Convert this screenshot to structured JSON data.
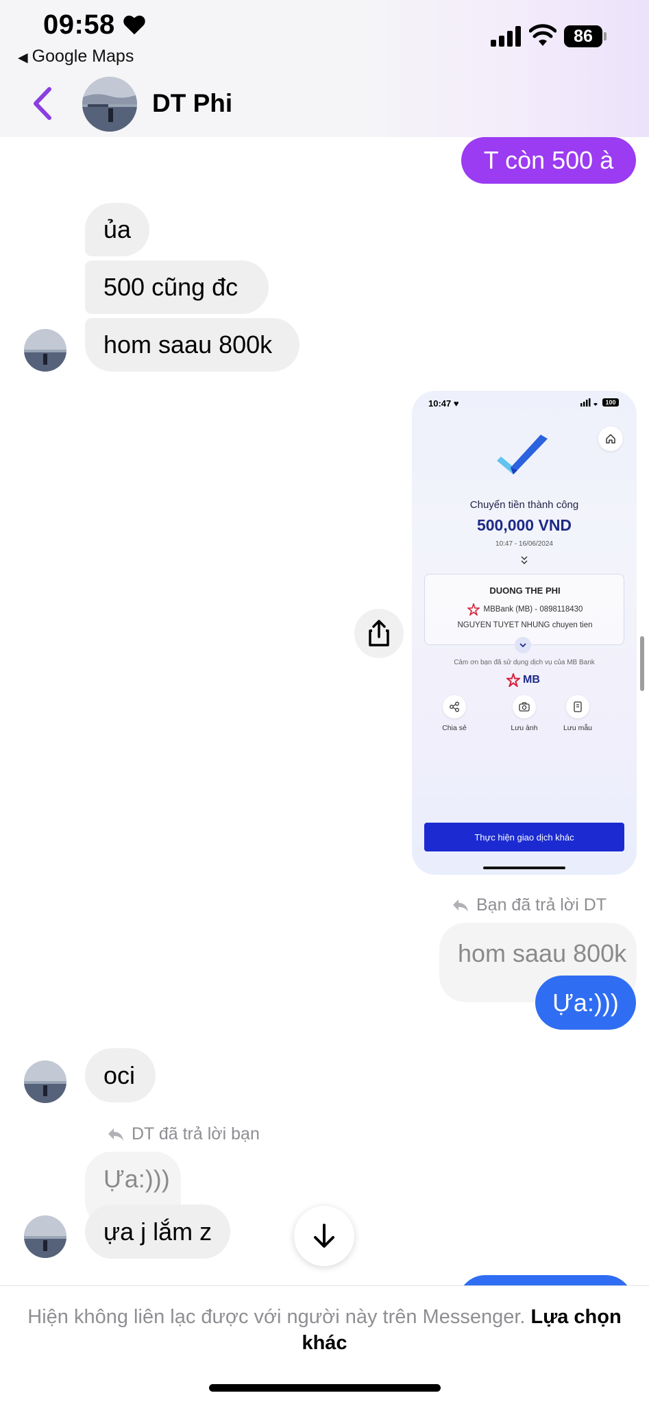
{
  "status_bar": {
    "time": "09:58",
    "back_app": "Google Maps",
    "battery": "86"
  },
  "header": {
    "contact_name": "DT Phi"
  },
  "messages": [
    {
      "text": "T còn 500 à"
    },
    {
      "text": "ủa"
    },
    {
      "text": "500 cũng đc"
    },
    {
      "text": "hom saau 800k"
    },
    {
      "reply_note": "Bạn đã trả lời DT",
      "quoted": "hom saau 800k",
      "text": "Ựa:)))"
    },
    {
      "text": "oci"
    },
    {
      "reply_note": "DT đã trả lời bạn",
      "quoted": "Ựa:)))",
      "text": "ựa j lắm z"
    }
  ],
  "receipt": {
    "time": "10:47",
    "battery": "100",
    "title": "Chuyển tiền thành công",
    "amount": "500,000 VND",
    "datetime": "10:47 - 16/06/2024",
    "recipient_name": "DUONG THE PHI",
    "bank_line": "MBBank (MB) - 0898118430",
    "note": "NGUYEN TUYET NHUNG chuyen tien",
    "thanks": "Cảm ơn bạn đã sử dụng dịch vụ của MB Bank",
    "bank_logo": "MB",
    "actions": [
      "Chia sẻ",
      "Lưu ảnh",
      "Lưu mẫu"
    ],
    "cta": "Thực hiện giao dịch khác"
  },
  "footer": {
    "message": "Hiện không liên lạc được với người này trên Messenger.",
    "link": "Lựa chọn khác"
  },
  "colors": {
    "purple_bubble": "#9b3bf2",
    "blue_bubble": "#2f6df2",
    "incoming_bubble": "#efefef",
    "accent": "#8a3fe0"
  }
}
